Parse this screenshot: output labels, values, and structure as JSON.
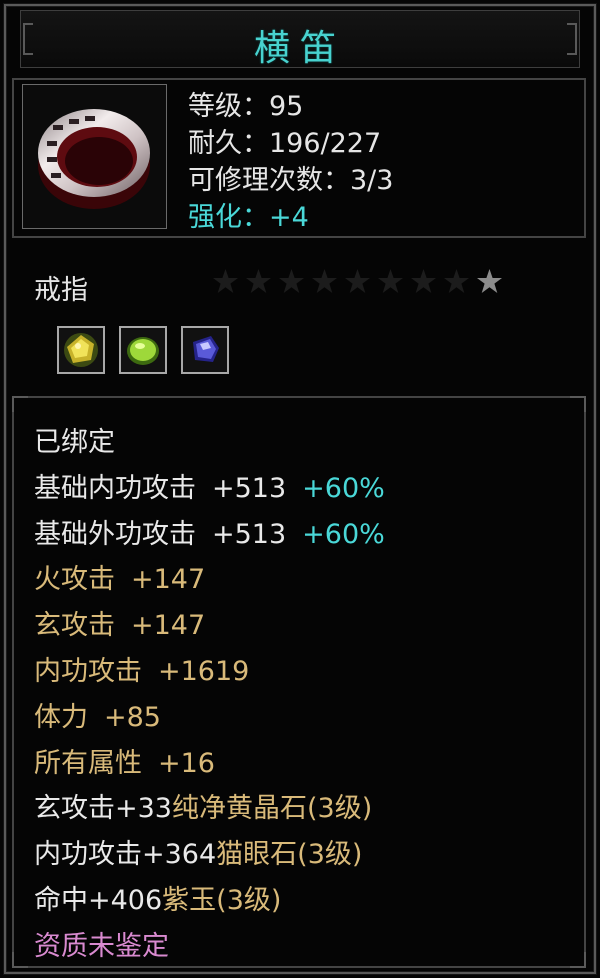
{
  "title": "横笛",
  "stats": {
    "level": "等级：95",
    "durability": "耐久：196/227",
    "repairs": "可修理次数：3/3",
    "enhance": "强化：+4"
  },
  "item_type": "戒指",
  "stars_total": 9,
  "stars_lit": 1,
  "gems": [
    {
      "icon": "yellow-crystal-gem-icon",
      "color": "#d4c63a"
    },
    {
      "icon": "cats-eye-gem-icon",
      "color": "#9fd83a"
    },
    {
      "icon": "purple-jade-gem-icon",
      "color": "#5a5ad8"
    }
  ],
  "bound": "已绑定",
  "attributes": [
    {
      "name": "基础内功攻击",
      "value": "+513",
      "bonus": "+60%"
    },
    {
      "name": "基础外功攻击",
      "value": "+513",
      "bonus": "+60%"
    }
  ],
  "bonus_stats": [
    {
      "name": "火攻击",
      "value": "+147"
    },
    {
      "name": "玄攻击",
      "value": "+147"
    },
    {
      "name": "内功攻击",
      "value": "+1619"
    },
    {
      "name": "体力",
      "value": "+85"
    },
    {
      "name": "所有属性",
      "value": "+16"
    }
  ],
  "gem_lines": [
    {
      "stat": "玄攻击+33",
      "gem": "纯净黄晶石(3级)"
    },
    {
      "stat": "内功攻击+364",
      "gem": "猫眼石(3级)"
    },
    {
      "stat": "命中+406",
      "gem": "紫玉(3级)"
    }
  ],
  "quality": "资质未鉴定",
  "colors": {
    "cyan": "#4ad8d8",
    "gold": "#d9ba7a",
    "pink": "#d98ad0",
    "white": "#e9e9e9"
  }
}
